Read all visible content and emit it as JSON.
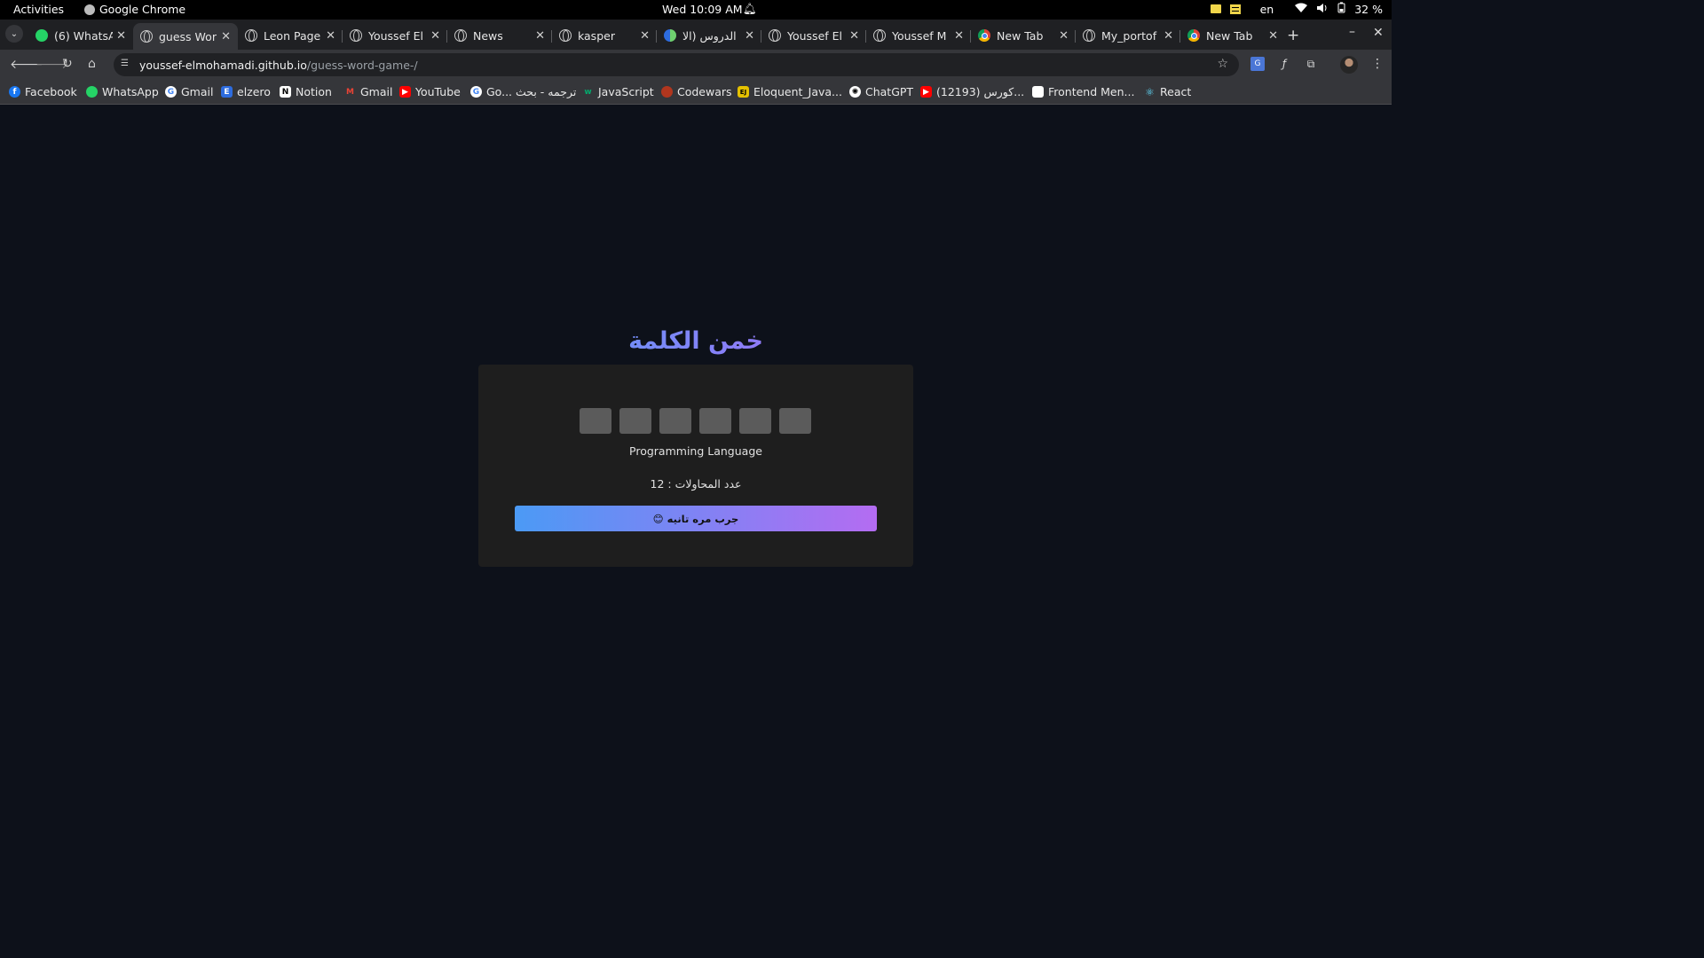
{
  "os_bar": {
    "activities": "Activities",
    "app_name": "Google Chrome",
    "clock": "Wed 10:09 AM",
    "language": "en",
    "battery": "32 %"
  },
  "tabs": [
    {
      "title": "(6) WhatsA",
      "icon": "whatsapp-icon",
      "active": false
    },
    {
      "title": "guess Wor",
      "icon": "globe-icon",
      "active": true
    },
    {
      "title": "Leon Page",
      "icon": "globe-icon",
      "active": false
    },
    {
      "title": "Youssef El",
      "icon": "globe-icon",
      "active": false
    },
    {
      "title": "News",
      "icon": "globe-icon",
      "active": false
    },
    {
      "title": "kasper",
      "icon": "globe-icon",
      "active": false
    },
    {
      "title": "الدروس (الا",
      "icon": "doc-icon",
      "active": false
    },
    {
      "title": "Youssef El",
      "icon": "globe-icon",
      "active": false
    },
    {
      "title": "Youssef M",
      "icon": "globe-icon",
      "active": false
    },
    {
      "title": "New Tab",
      "icon": "chrome-icon",
      "active": false
    },
    {
      "title": "My_portof",
      "icon": "globe-icon",
      "active": false
    },
    {
      "title": "New Tab",
      "icon": "chrome-icon",
      "active": false
    }
  ],
  "omnibox": {
    "host": "youssef-elmohamadi.github.io",
    "path": "/guess-word-game-/"
  },
  "bookmarks": [
    {
      "label": "Facebook",
      "icon": "facebook-icon",
      "color": "#1877f2"
    },
    {
      "label": "WhatsApp",
      "icon": "whatsapp-icon",
      "color": "#25d366"
    },
    {
      "label": "Gmail",
      "icon": "google-icon",
      "color": "#ffffff"
    },
    {
      "label": "elzero",
      "icon": "elzero-icon",
      "color": "#2d6cdf"
    },
    {
      "label": "Notion",
      "icon": "notion-icon",
      "color": "#ffffff"
    },
    {
      "label": "Gmail",
      "icon": "gmail-icon",
      "color": "#ea4335"
    },
    {
      "label": "YouTube",
      "icon": "youtube-icon",
      "color": "#ff0000"
    },
    {
      "label": "Go... ترجمه - بحث",
      "icon": "google-icon",
      "color": "#ffffff"
    },
    {
      "label": "JavaScript",
      "icon": "w3-icon",
      "color": "#04aa6d"
    },
    {
      "label": "Codewars",
      "icon": "codewars-icon",
      "color": "#b1361e"
    },
    {
      "label": "Eloquent_Java...",
      "icon": "eloquent-js-icon",
      "color": "#e5c100"
    },
    {
      "label": "ChatGPT",
      "icon": "chatgpt-icon",
      "color": "#ffffff"
    },
    {
      "label": "(12193) كورس...",
      "icon": "youtube-icon",
      "color": "#ff0000"
    },
    {
      "label": "Frontend Men...",
      "icon": "page-icon",
      "color": "#ffffff"
    },
    {
      "label": "React",
      "icon": "react-icon",
      "color": "#61dafb"
    }
  ],
  "game": {
    "title": "خمن الكلمة",
    "slot_count": 6,
    "hint": "Programming Language",
    "attempts_text": "عدد المحاولات : 12",
    "retry_label": "جرب مره تانيه 😊"
  }
}
